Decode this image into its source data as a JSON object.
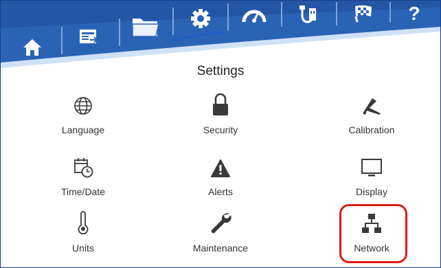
{
  "colors": {
    "bar_blue": "#2b63b4",
    "bar_light": "#cfe1f7",
    "accent_underline": "#1f5fc0",
    "icon_grey": "#3a3a3a",
    "highlight_red": "#e11919"
  },
  "nav": {
    "items": [
      {
        "name": "home",
        "icon": "home-icon"
      },
      {
        "name": "display",
        "icon": "screen-export-icon"
      },
      {
        "name": "files",
        "icon": "folder-icon"
      },
      {
        "name": "settings",
        "icon": "gear-icon",
        "active": true
      },
      {
        "name": "gauge",
        "icon": "gauge-icon"
      },
      {
        "name": "connect",
        "icon": "usb-cable-icon"
      },
      {
        "name": "finish",
        "icon": "checkered-flag-icon"
      },
      {
        "name": "help",
        "icon": "question-icon",
        "label": "?"
      }
    ]
  },
  "page": {
    "title": "Settings"
  },
  "tiles": [
    {
      "label": "Language",
      "icon": "globe-icon"
    },
    {
      "label": "Security",
      "icon": "lock-icon"
    },
    {
      "label": "Calibration",
      "icon": "caliper-icon"
    },
    {
      "label": "Time/Date",
      "icon": "calendar-clock-icon"
    },
    {
      "label": "Alerts",
      "icon": "warning-icon"
    },
    {
      "label": "Display",
      "icon": "monitor-icon"
    },
    {
      "label": "Units",
      "icon": "thermometer-icon"
    },
    {
      "label": "Maintenance",
      "icon": "wrench-icon"
    },
    {
      "label": "Network",
      "icon": "network-icon",
      "highlighted": true
    }
  ]
}
